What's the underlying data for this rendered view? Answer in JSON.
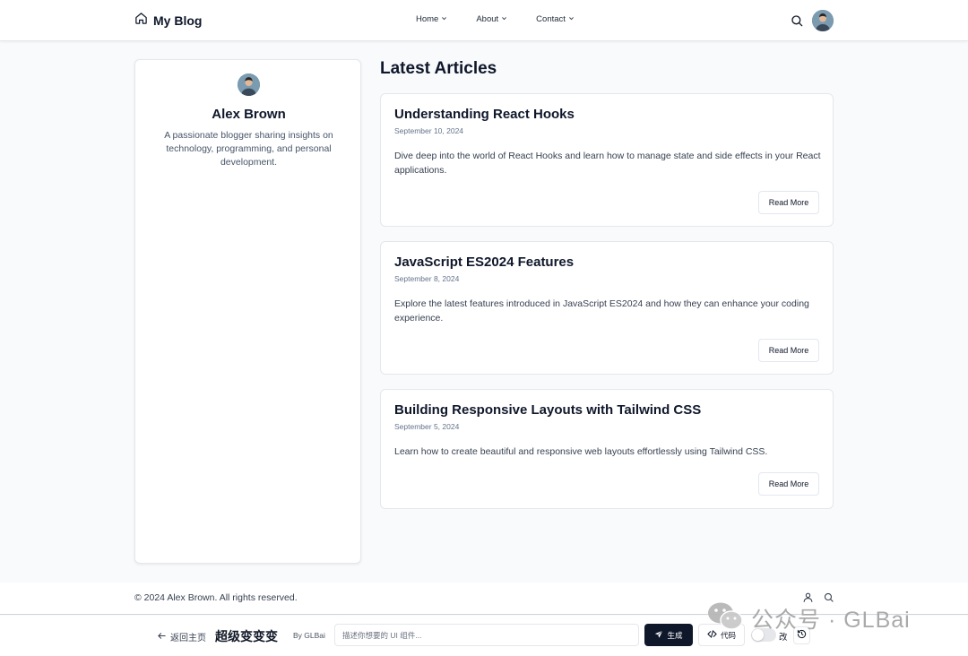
{
  "header": {
    "brand_title": "My Blog",
    "nav": [
      {
        "label": "Home"
      },
      {
        "label": "About"
      },
      {
        "label": "Contact"
      }
    ]
  },
  "profile": {
    "name": "Alex Brown",
    "bio": "A passionate blogger sharing insights on technology, programming, and personal development."
  },
  "main": {
    "section_title": "Latest Articles",
    "articles": [
      {
        "title": "Understanding React Hooks",
        "date": "September 10, 2024",
        "excerpt": "Dive deep into the world of React Hooks and learn how to manage state and side effects in your React applications.",
        "read_more": "Read More"
      },
      {
        "title": "JavaScript ES2024 Features",
        "date": "September 8, 2024",
        "excerpt": "Explore the latest features introduced in JavaScript ES2024 and how they can enhance your coding experience.",
        "read_more": "Read More"
      },
      {
        "title": "Building Responsive Layouts with Tailwind CSS",
        "date": "September 5, 2024",
        "excerpt": "Learn how to create beautiful and responsive web layouts effortlessly using Tailwind CSS.",
        "read_more": "Read More"
      }
    ]
  },
  "footer": {
    "copyright": "© 2024 Alex Brown. All rights reserved."
  },
  "toolbar": {
    "back_label": "返回主页",
    "title": "超级变变变",
    "by": "By GLBai",
    "prompt_placeholder": "描述你想要的 UI 组件...",
    "generate_label": "生成",
    "code_label": "代码",
    "toggle_label": "改"
  },
  "watermark": {
    "text": "公众号 · GLBai"
  },
  "colors": {
    "page_bg": "#f8fafc",
    "card_bg": "#ffffff",
    "border": "#e5e7eb",
    "text_primary": "#0f172a",
    "text_muted": "#64748b",
    "button_dark": "#0f172a"
  }
}
